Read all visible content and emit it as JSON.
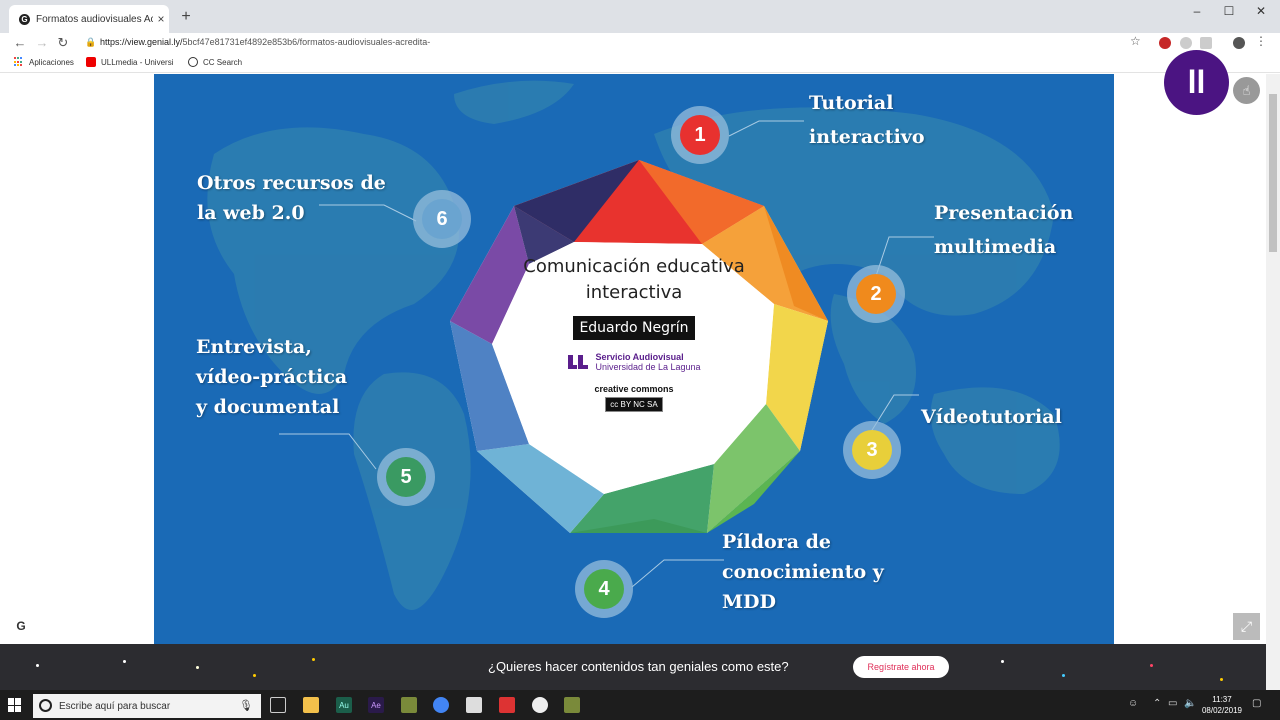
{
  "browser": {
    "tab_title": "Formatos audiovisuales Acredita",
    "tab_close": "×",
    "new_tab": "+",
    "url_host": "https://view.genial.ly/",
    "url_path": "5bcf47e81731ef4892e853b6/formatos-audiovisuales-acredita-",
    "window_controls": [
      "–",
      "☐",
      "✕"
    ],
    "bookmarks": [
      "Aplicaciones",
      "ULLmedia - Universi",
      "CC Search"
    ]
  },
  "slide": {
    "title": "Comunicación educativa interactiva",
    "author": "Eduardo Negrín",
    "service_name": "Servicio Audiovisual",
    "service_org": "Universidad de La Laguna",
    "cc_text": "creative commons",
    "cc_badge": "cc BY NC SA",
    "items": [
      {
        "num": "1",
        "label": "Tutorial interactivo",
        "color": "#e8312f"
      },
      {
        "num": "2",
        "label": "Presentación multimedia",
        "color": "#f08a1c"
      },
      {
        "num": "3",
        "label": "Vídeotutorial",
        "color": "#e8cf3a"
      },
      {
        "num": "4",
        "label": "Píldora de conocimiento y MDD",
        "color": "#4aaa4c"
      },
      {
        "num": "5",
        "label": "Entrevista, vídeo-práctica y documental",
        "color": "#3a9a62"
      },
      {
        "num": "6",
        "label": "Otros recursos de la web 2.0",
        "color": "#6aa4d0"
      }
    ]
  },
  "item_lines": {
    "1": [
      "Tutorial",
      "interactivo"
    ],
    "2": [
      "Presentación",
      "multimedia"
    ],
    "3": [
      "Vídeotutorial"
    ],
    "4": [
      "Píldora de",
      "conocimiento y",
      "MDD"
    ],
    "5": [
      "Entrevista,",
      "vídeo-práctica",
      "y documental"
    ],
    "6": [
      "Otros recursos de",
      "la web 2.0"
    ]
  },
  "genially_mark": "genially",
  "banner": {
    "message": "¿Quieres hacer contenidos tan geniales como este?",
    "cta": "Regístrate ahora"
  },
  "taskbar": {
    "search_placeholder": "Escribe aquí para buscar",
    "time": "11:37",
    "date": "08/02/2019"
  }
}
